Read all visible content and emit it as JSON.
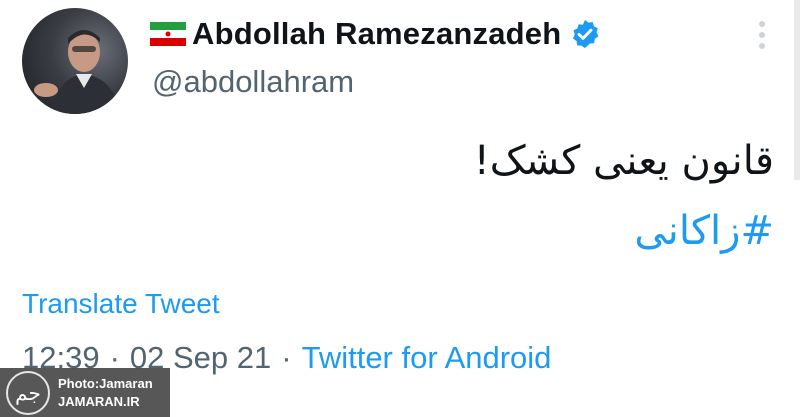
{
  "tweet": {
    "display_name": "Abdollah Ramezanzadeh",
    "handle": "@abdollahram",
    "body": "قانون یعنی کشک!",
    "hashtag": "#زاکانی",
    "translate_label": "Translate Tweet",
    "time": "12:39",
    "date": "02 Sep 21",
    "separator": "·",
    "source": "Twitter for Android",
    "icons": {
      "flag": "iran-flag-icon",
      "verified": "verified-badge-icon",
      "more": "more-options-icon"
    },
    "colors": {
      "accent": "#1d9bf0",
      "secondary_text": "#536471",
      "primary_text": "#0f1419"
    }
  },
  "watermark": {
    "logo_glyph": "جم",
    "line1": "Photo:Jamaran",
    "line2": "JAMARAN.IR"
  }
}
